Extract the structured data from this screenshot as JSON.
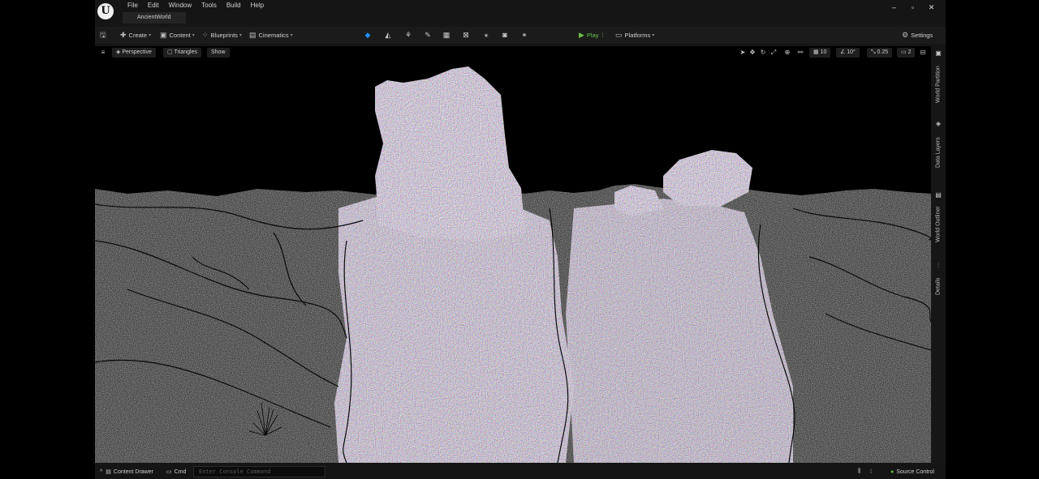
{
  "app": {
    "logo_glyph": "U"
  },
  "menu": [
    "File",
    "Edit",
    "Window",
    "Tools",
    "Build",
    "Help"
  ],
  "document_tab": "AncientWorld",
  "window_controls": {
    "minimize": "–",
    "maximize": "▫",
    "close": "✕"
  },
  "toolbar": {
    "create": "Create",
    "content": "Content",
    "blueprints": "Blueprints",
    "cinematics": "Cinematics",
    "play": "Play",
    "platforms": "Platforms",
    "settings": "Settings"
  },
  "viewport": {
    "perspective": "Perspective",
    "view_mode": "Triangles",
    "show": "Show",
    "grid_snap": "10",
    "rotation_snap": "10°",
    "scale_snap": "0.25",
    "camera_speed": "2"
  },
  "side_tabs": [
    "World Partition",
    "Data Layers",
    "World Outliner",
    "Details"
  ],
  "status_bar": {
    "content_drawer": "Content Drawer",
    "cmd": "Cmd",
    "console_placeholder": "Enter Console Command",
    "source_control": "Source Control"
  },
  "colors": {
    "background": "#151515",
    "viewport_bg": "#000000",
    "play_green": "#6cc04a",
    "accent_blue": "#1e90ff",
    "terrain_gray": "#8f8f94"
  }
}
